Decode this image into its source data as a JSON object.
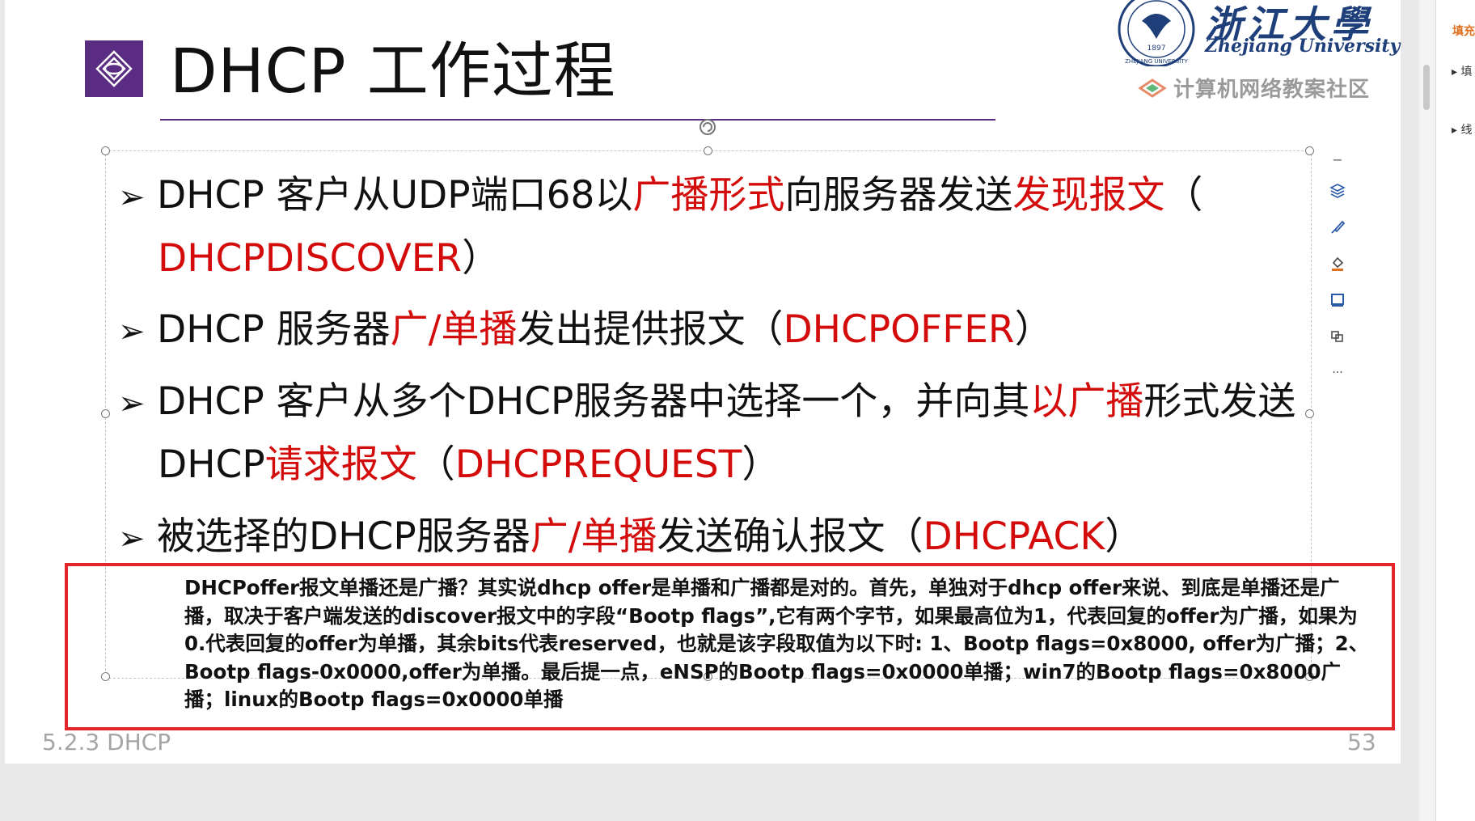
{
  "slide": {
    "title": "DHCP 工作过程",
    "university_cn": "浙江大學",
    "university_en": "Zhejiang University",
    "community": "计算机网络教案社区",
    "seal_year": "1897",
    "seal_text": "ZHEJIANG UNIVERSITY",
    "bullet_marker": "➢",
    "bullets": [
      {
        "line1": [
          {
            "t": "DHCP 客户从UDP端口68以",
            "red": false
          },
          {
            "t": "广播形式",
            "red": true
          },
          {
            "t": "向服务器发送",
            "red": false
          },
          {
            "t": "发现报文",
            "red": true
          },
          {
            "t": "（",
            "red": false
          }
        ],
        "line2": [
          {
            "t": "DHCPDISCOVER",
            "red": true
          },
          {
            "t": "）",
            "red": false
          }
        ]
      },
      {
        "line1": [
          {
            "t": "DHCP 服务器",
            "red": false
          },
          {
            "t": "广/单播",
            "red": true
          },
          {
            "t": "发出提供报文（",
            "red": false
          },
          {
            "t": "DHCPOFFER",
            "red": true
          },
          {
            "t": "）",
            "red": false
          }
        ],
        "line2": []
      },
      {
        "line1": [
          {
            "t": "DHCP 客户从多个DHCP服务器中选择一个，并向其",
            "red": false
          },
          {
            "t": "以广播",
            "red": true
          },
          {
            "t": "形式发送",
            "red": false
          }
        ],
        "line2": [
          {
            "t": "DHCP",
            "red": false
          },
          {
            "t": "请求报文",
            "red": true
          },
          {
            "t": "（",
            "red": false
          },
          {
            "t": "DHCPREQUEST",
            "red": true
          },
          {
            "t": "）",
            "red": false
          }
        ]
      },
      {
        "line1": [
          {
            "t": "被选择的DHCP服务器",
            "red": false
          },
          {
            "t": "广/单播",
            "red": true
          },
          {
            "t": "发送确认报文（",
            "red": false
          },
          {
            "t": "DHCPACK",
            "red": true
          },
          {
            "t": "）",
            "red": false
          }
        ],
        "line2": []
      }
    ],
    "note": "DHCPoffer报文单播还是广播？其实说dhcp offer是单播和广播都是对的。首先，单独对于dhcp offer来说、到底是单播还是广播，取决于客户端发送的discover报文中的字段“Bootp flags”,它有两个字节，如果最高位为1，代表回复的offer为广播，如果为0.代表回复的offer为单播，其余bits代表reserved，也就是该字段取值为以下时: 1、Bootp flags=0x8000, offer为广播；2、Bootp flags-0x0000,offer为单播。最后提一点，eNSP的Bootp flags=0x0000单播；win7的Bootp flags=0x8000广播；linux的Bootp flags=0x0000单播",
    "footer_section": "5.2.3 DHCP",
    "page_number": "53"
  },
  "toolbar": {
    "collapse_label": "−",
    "more_label": "···",
    "icons": [
      "layers-icon",
      "brush-icon",
      "fill-icon",
      "outline-icon",
      "effects-icon"
    ]
  },
  "right_panel": {
    "header": "填充",
    "items": [
      "▸ 填",
      "▸ 线"
    ]
  },
  "colors": {
    "accent": "#5b2d82",
    "highlight_red": "#d40b0b",
    "note_border": "#e3242b"
  }
}
